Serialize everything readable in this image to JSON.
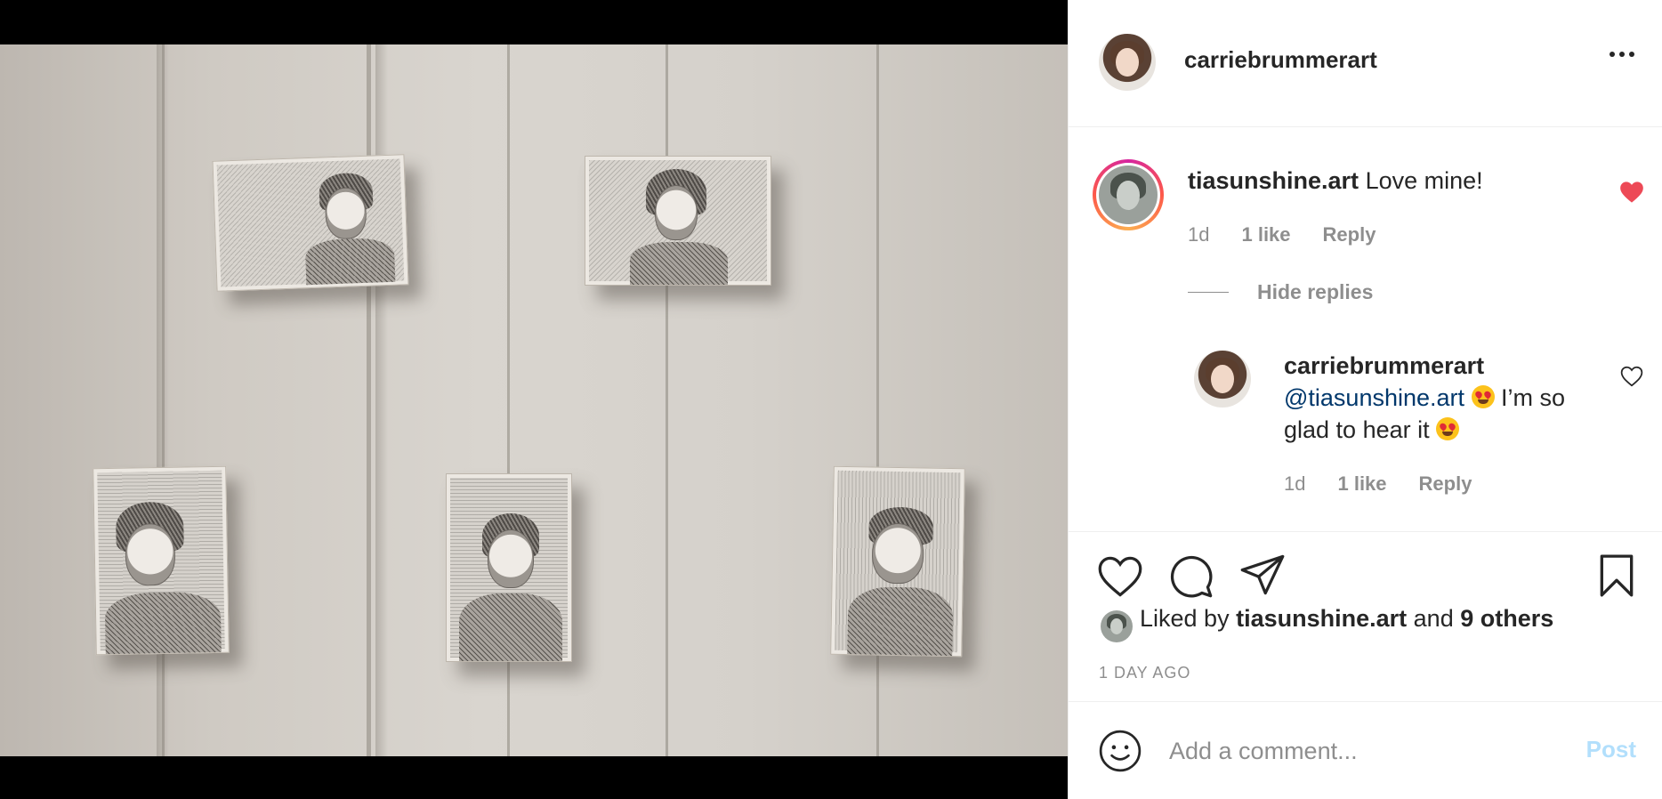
{
  "post": {
    "author": "carriebrummerart",
    "image_alt": "Five small drawings on canvas blocks hung on a white paneled wall"
  },
  "comments": [
    {
      "username": "tiasunshine.art",
      "text": "Love mine!",
      "age": "1d",
      "likes": "1 like",
      "reply_label": "Reply",
      "liked": true
    }
  ],
  "replies_toggle": "Hide replies",
  "reply": {
    "username": "carriebrummerart",
    "mention": "@tiasunshine.art",
    "text_part1": "I’m so",
    "text_part2": "glad to hear it",
    "age": "1d",
    "likes": "1 like",
    "reply_label": "Reply"
  },
  "likes": {
    "prefix": "Liked by",
    "first_user": "tiasunshine.art",
    "conjunction": "and",
    "others": "9 others"
  },
  "timestamp": "1 DAY AGO",
  "comment_box": {
    "placeholder": "Add a comment...",
    "post_label": "Post"
  },
  "colors": {
    "heart_active": "#ed4956",
    "mention": "#00376b",
    "post_disabled": "#b2dffc",
    "muted": "#8e8e8e"
  },
  "icons": [
    "more-options-icon",
    "heart-icon",
    "comment-icon",
    "share-icon",
    "bookmark-icon",
    "emoji-icon"
  ]
}
